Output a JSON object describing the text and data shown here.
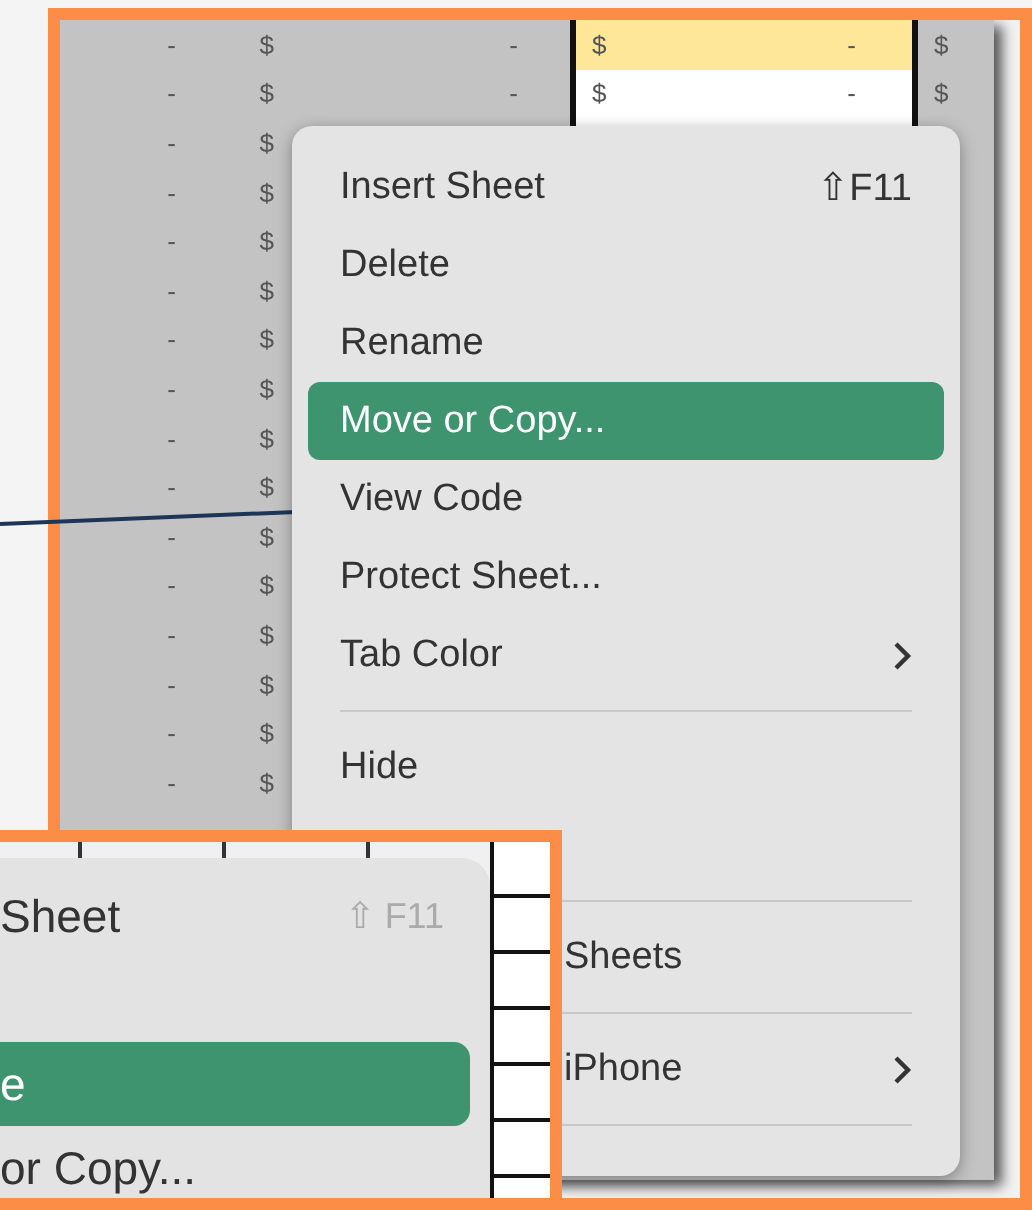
{
  "sheet": {
    "rows": [
      {
        "column_1": "-",
        "column_2": "$",
        "column_3": "-",
        "column_4": "$",
        "column_5": "-",
        "column_6": "$",
        "highlighted": true
      },
      {
        "column_1": "-",
        "column_2": "$",
        "column_3": "-",
        "column_4": "$",
        "column_5": "-",
        "column_6": "$",
        "highlighted": false
      },
      {
        "column_1": "-",
        "column_2": "$",
        "highlighted": false
      },
      {
        "column_1": "-",
        "column_2": "$",
        "highlighted": false
      },
      {
        "column_1": "-",
        "column_2": "$",
        "highlighted": false
      },
      {
        "column_1": "-",
        "column_2": "$",
        "highlighted": false
      },
      {
        "column_1": "-",
        "column_2": "$",
        "highlighted": false
      },
      {
        "column_1": "-",
        "column_2": "$",
        "highlighted": false
      },
      {
        "column_1": "-",
        "column_2": "$",
        "highlighted": false
      },
      {
        "column_1": "-",
        "column_2": "$",
        "highlighted": false
      },
      {
        "column_1": "-",
        "column_2": "$",
        "highlighted": false
      },
      {
        "column_1": "-",
        "column_2": "$",
        "highlighted": false
      },
      {
        "column_1": "-",
        "column_2": "$",
        "highlighted": false
      },
      {
        "column_1": "-",
        "column_2": "$",
        "highlighted": false
      },
      {
        "column_1": "-",
        "column_2": "$",
        "highlighted": false
      },
      {
        "column_1": "-",
        "column_2": "$",
        "highlighted": false
      }
    ]
  },
  "context_menu": {
    "items": [
      {
        "kind": "item",
        "label": "Insert Sheet",
        "shortcut": "⇧F11",
        "submenu": false,
        "selected": false
      },
      {
        "kind": "item",
        "label": "Delete",
        "submenu": false,
        "selected": false
      },
      {
        "kind": "item",
        "label": "Rename",
        "submenu": false,
        "selected": false
      },
      {
        "kind": "item",
        "label": "Move or Copy...",
        "submenu": false,
        "selected": true
      },
      {
        "kind": "item",
        "label": "View Code",
        "submenu": false,
        "selected": false
      },
      {
        "kind": "item",
        "label": "Protect Sheet...",
        "submenu": false,
        "selected": false
      },
      {
        "kind": "item",
        "label": "Tab Color",
        "submenu": true,
        "selected": false
      },
      {
        "kind": "separator"
      },
      {
        "kind": "item",
        "label": "Hide",
        "submenu": false,
        "selected": false
      },
      {
        "kind": "blank"
      },
      {
        "kind": "separator"
      },
      {
        "kind": "clipped",
        "label": "Sheets",
        "submenu": false,
        "selected": false
      },
      {
        "kind": "separator"
      },
      {
        "kind": "clipped",
        "label": "iPhone",
        "submenu": true,
        "selected": false
      },
      {
        "kind": "separator"
      }
    ]
  },
  "zoom_callout": {
    "items": [
      {
        "kind": "item",
        "label": "Sheet",
        "shortcut": "⇧ F11",
        "selected": false
      },
      {
        "kind": "blank"
      },
      {
        "kind": "item",
        "label": "e",
        "selected": true
      },
      {
        "kind": "item",
        "label": "or Copy...",
        "selected": false
      }
    ]
  }
}
